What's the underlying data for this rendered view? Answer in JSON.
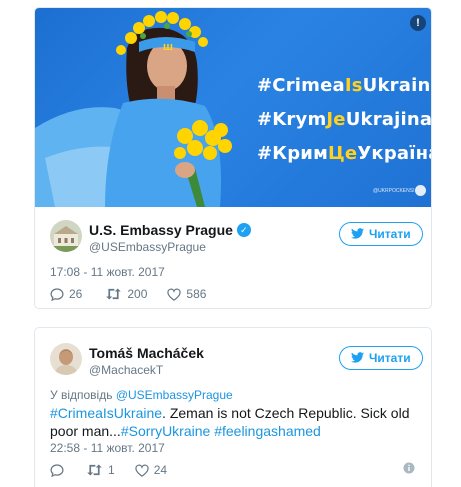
{
  "tweet1": {
    "image": {
      "hashtags": [
        {
          "pre": "#Crimea",
          "hl": "Is",
          "post": "Ukraine"
        },
        {
          "pre": "#Krym",
          "hl": "Je",
          "post": "Ukrajina"
        },
        {
          "pre": "#Крим",
          "hl": "Це",
          "post": "Україна"
        }
      ],
      "watermark": "@UKRPOCKENSI",
      "colors": {
        "background": "#1f76d8",
        "highlight": "#ffd21f",
        "flowers": "#ffd400"
      }
    },
    "author": {
      "name": "U.S. Embassy Prague",
      "handle": "@USEmbassyPrague",
      "verified": true
    },
    "follow_label": "Читати",
    "timestamp": "17:08 - 11 жовт. 2017",
    "counts": {
      "replies": "26",
      "retweets": "200",
      "likes": "586"
    }
  },
  "tweet2": {
    "author": {
      "name": "Tomáš Macháček",
      "handle": "@MachacekT"
    },
    "follow_label": "Читати",
    "reply_prefix": "У відповідь",
    "reply_to": "@USEmbassyPrague",
    "text": {
      "tag1": "#CrimeaIsUkraine",
      "body1": ". Zeman is not Czech Republic. Sick old poor man...",
      "tag2": "#SorryUkraine",
      "tag3": "#feelingashamed"
    },
    "timestamp": "22:58 - 11 жовт. 2017",
    "counts": {
      "replies": "",
      "retweets": "1",
      "likes": "24"
    }
  },
  "colors": {
    "accent": "#1da1f2",
    "link": "#1b95e0",
    "muted": "#657786",
    "border": "#e1e8ed"
  }
}
